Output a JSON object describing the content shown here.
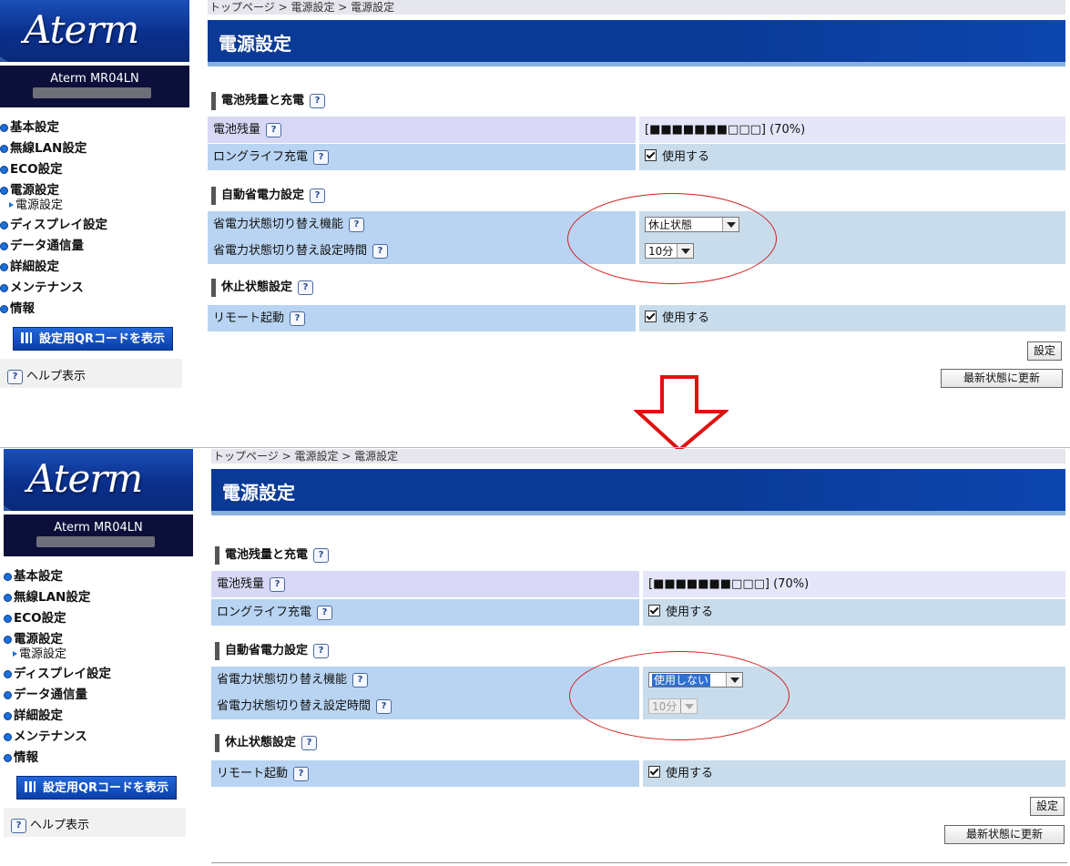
{
  "brand": "Aterm",
  "model": "Aterm MR04LN",
  "breadcrumb": "トップページ > 電源設定 > 電源設定",
  "page_title": "電源設定",
  "nav": [
    "基本設定",
    "無線LAN設定",
    "ECO設定",
    "電源設定",
    "電源設定",
    "ディスプレイ設定",
    "データ通信量",
    "詳細設定",
    "メンテナンス",
    "情報"
  ],
  "qr_button": "設定用QRコードを表示",
  "help": "ヘルプ表示",
  "help_icon": "?",
  "sections": {
    "battery": {
      "heading": "電池残量と充電",
      "level_label": "電池残量",
      "level_value": "[■■■■■■■□□□] (70%)",
      "level_fraction": 0.7,
      "longlife_label": "ロングライフ充電",
      "longlife_value": "使用する"
    },
    "autosave": {
      "heading": "自動省電力設定",
      "switch_label": "省電力状態切り替え機能",
      "time_label": "省電力状態切り替え設定時間"
    },
    "sleep": {
      "heading": "休止状態設定",
      "remote_label": "リモート起動",
      "remote_value": "使用する"
    }
  },
  "before": {
    "switch_value": "休止状態",
    "time_value": "10分"
  },
  "after": {
    "switch_value": "使用しない",
    "time_value": "10分"
  },
  "buttons": {
    "apply": "設定",
    "refresh": "最新状態に更新"
  },
  "colors": {
    "title_bar": "#0a3a96",
    "annotation": "#d42020",
    "arrow": "#e01010"
  }
}
